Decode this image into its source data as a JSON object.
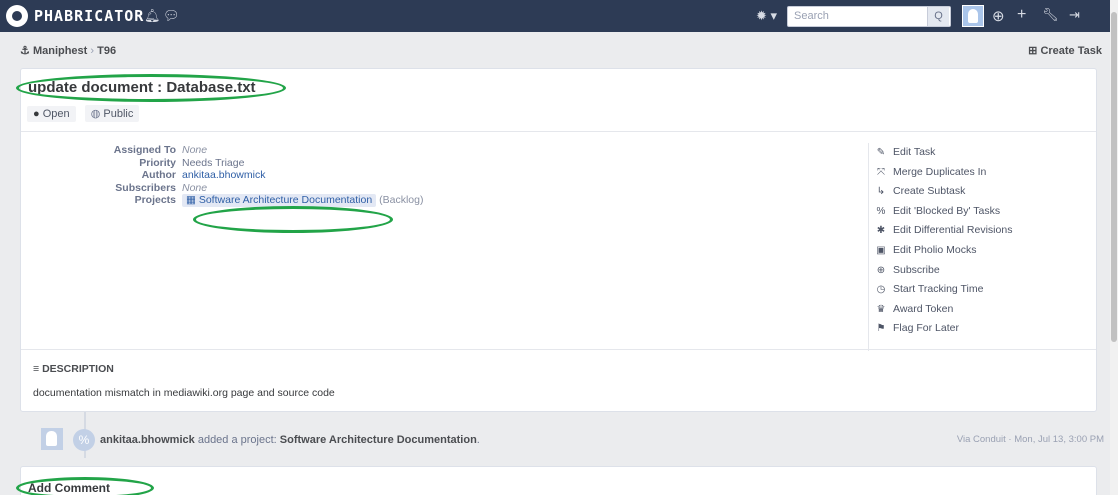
{
  "topbar": {
    "brand": "PHABRICATOR",
    "icons": [
      "phabricator-logo-icon",
      "bell-icon",
      "chat-icon",
      "gear-icon",
      "search-icon",
      "avatar-icon",
      "help-icon",
      "plus-icon",
      "wrench-icon",
      "logout-icon"
    ],
    "search_placeholder": "Search",
    "search_button": "Q"
  },
  "breadcrumb": {
    "app": "Maniphest",
    "separator": "›",
    "item": "T96",
    "create_task": "Create Task"
  },
  "task": {
    "title": "update document : Database.txt",
    "status": "Open",
    "visibility": "Public",
    "properties": {
      "assigned_label": "Assigned To",
      "assigned_value": "None",
      "priority_label": "Priority",
      "priority_value": "Needs Triage",
      "author_label": "Author",
      "author_value": "ankitaa.bhowmick",
      "subscribers_label": "Subscribers",
      "subscribers_value": "None",
      "projects_label": "Projects",
      "project_name": "Software Architecture Documentation",
      "project_column": "(Backlog)"
    },
    "actions": [
      {
        "label": "Edit Task",
        "icon": "pencil-icon",
        "glyph": "✎"
      },
      {
        "label": "Merge Duplicates In",
        "icon": "merge-icon",
        "glyph": "⤧"
      },
      {
        "label": "Create Subtask",
        "icon": "subtask-icon",
        "glyph": "↳"
      },
      {
        "label": "Edit 'Blocked By' Tasks",
        "icon": "link-icon",
        "glyph": "%"
      },
      {
        "label": "Edit Differential Revisions",
        "icon": "gear-icon",
        "glyph": "✱"
      },
      {
        "label": "Edit Pholio Mocks",
        "icon": "image-icon",
        "glyph": "▣"
      },
      {
        "label": "Subscribe",
        "icon": "plus-circle-icon",
        "glyph": "⊕"
      },
      {
        "label": "Start Tracking Time",
        "icon": "clock-icon",
        "glyph": "◷"
      },
      {
        "label": "Award Token",
        "icon": "trophy-icon",
        "glyph": "♛"
      },
      {
        "label": "Flag For Later",
        "icon": "flag-icon",
        "glyph": "⚑"
      }
    ],
    "description_heading": "DESCRIPTION",
    "description_body": "documentation mismatch in mediawiki.org page and source code"
  },
  "timeline": {
    "user": "ankitaa.bhowmick",
    "action": "added a project:",
    "project": "Software Architecture Documentation",
    "meta": "Via Conduit · Mon, Jul 13, 3:00 PM"
  },
  "comment": {
    "heading": "Add Comment"
  },
  "colors": {
    "topbar": "#2d3b55",
    "link": "#2f5fa6",
    "annotation": "#22a448"
  }
}
